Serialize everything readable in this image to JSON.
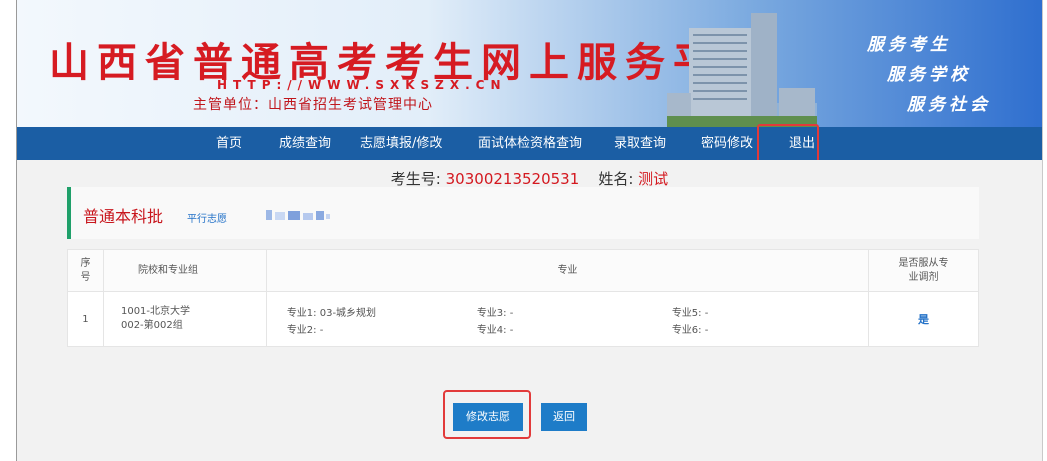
{
  "banner": {
    "title": "山西省普通高考考生网上服务平台",
    "url": "HTTP://WWW.SXKSZX.CN",
    "org": "主管单位：山西省招生考试管理中心",
    "slogans": [
      "服务考生",
      "服务学校",
      "服务社会"
    ]
  },
  "nav": {
    "items": [
      "首页",
      "成绩查询",
      "志愿填报/修改",
      "面试体检资格查询",
      "录取查询",
      "密码修改",
      "退出"
    ]
  },
  "candidate": {
    "id_label": "考生号:",
    "id_value": "30300213520531",
    "name_label": "姓名:",
    "name_value": "测试"
  },
  "batch": {
    "title": "普通本科批",
    "tag": "平行志愿"
  },
  "table": {
    "headers": {
      "no": "序号",
      "school": "院校和专业组",
      "major": "专业",
      "adjust": "是否服从专业调剂"
    },
    "rows": [
      {
        "no": "1",
        "school_line1": "1001-北京大学",
        "school_line2": "002-第002组",
        "majors": [
          "专业1:  03-城乡规划",
          "专业2:  -",
          "专业3:  -",
          "专业4:  -",
          "专业5:  -",
          "专业6:  -"
        ],
        "adjust": "是"
      }
    ]
  },
  "actions": {
    "modify_label": "修改志愿",
    "back_label": "返回"
  },
  "colors": {
    "nav_bg": "#1b5ea4",
    "title_red": "#d61b22",
    "button_blue": "#1e7cc8",
    "highlight_red": "#e23a3a",
    "accent_green": "#1fa06a"
  }
}
